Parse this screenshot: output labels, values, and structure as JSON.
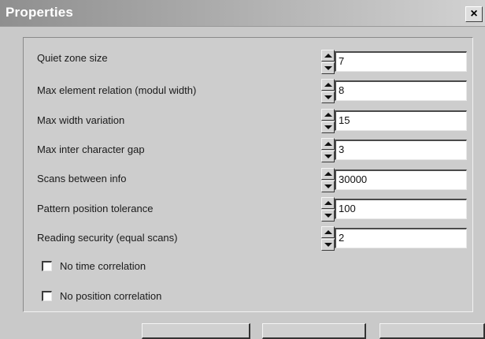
{
  "window": {
    "title": "Properties",
    "close_glyph": "×"
  },
  "fields": [
    {
      "label": "Quiet zone size",
      "value": "7"
    },
    {
      "label": "Max element relation (modul width)",
      "value": "8"
    },
    {
      "label": "Max width variation",
      "value": "15"
    },
    {
      "label": "Max inter character gap",
      "value": "3"
    },
    {
      "label": "Scans between info",
      "value": "30000"
    },
    {
      "label": "Pattern position tolerance",
      "value": "100"
    },
    {
      "label": "Reading security (equal scans)",
      "value": "2"
    }
  ],
  "checkboxes": [
    {
      "label": "No time correlation",
      "checked": false
    },
    {
      "label": "No position correlation",
      "checked": false
    }
  ],
  "icons": {
    "close": "close-icon",
    "spin_up": "arrow-up-icon",
    "spin_down": "arrow-down-icon"
  },
  "colors": {
    "titlebar_start": "#8f8f8f",
    "titlebar_end": "#d2d2d2",
    "dialog_bg": "#c9c9c9"
  }
}
